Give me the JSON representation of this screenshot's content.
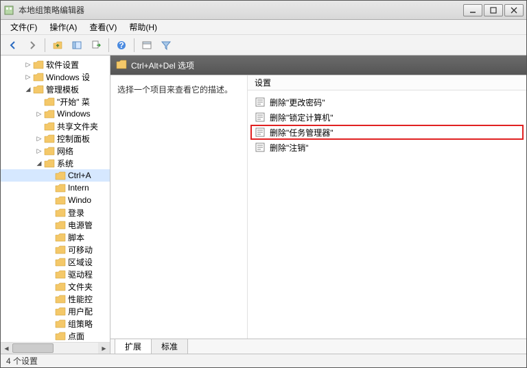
{
  "window": {
    "title": "本地组策略编辑器"
  },
  "menu": {
    "file": "文件(F)",
    "action": "操作(A)",
    "view": "查看(V)",
    "help": "帮助(H)"
  },
  "tree": {
    "items": [
      {
        "label": "软件设置",
        "indent": 1,
        "exp": "▷"
      },
      {
        "label": "Windows 设",
        "indent": 1,
        "exp": "▷"
      },
      {
        "label": "管理模板",
        "indent": 1,
        "exp": "◢"
      },
      {
        "label": "\"开始\" 菜",
        "indent": 2,
        "exp": ""
      },
      {
        "label": "Windows",
        "indent": 2,
        "exp": "▷"
      },
      {
        "label": "共享文件夹",
        "indent": 2,
        "exp": ""
      },
      {
        "label": "控制面板",
        "indent": 2,
        "exp": "▷"
      },
      {
        "label": "网络",
        "indent": 2,
        "exp": "▷"
      },
      {
        "label": "系统",
        "indent": 2,
        "exp": "◢"
      },
      {
        "label": "Ctrl+A",
        "indent": 3,
        "exp": "",
        "sel": true
      },
      {
        "label": "Intern",
        "indent": 3,
        "exp": ""
      },
      {
        "label": "Windo",
        "indent": 3,
        "exp": ""
      },
      {
        "label": "登录",
        "indent": 3,
        "exp": ""
      },
      {
        "label": "电源管",
        "indent": 3,
        "exp": ""
      },
      {
        "label": "脚本",
        "indent": 3,
        "exp": ""
      },
      {
        "label": "可移动",
        "indent": 3,
        "exp": ""
      },
      {
        "label": "区域设",
        "indent": 3,
        "exp": ""
      },
      {
        "label": "驱动程",
        "indent": 3,
        "exp": ""
      },
      {
        "label": "文件夹",
        "indent": 3,
        "exp": ""
      },
      {
        "label": "性能控",
        "indent": 3,
        "exp": ""
      },
      {
        "label": "用户配",
        "indent": 3,
        "exp": ""
      },
      {
        "label": "组策略",
        "indent": 3,
        "exp": ""
      },
      {
        "label": "点面",
        "indent": 3,
        "exp": ""
      }
    ]
  },
  "path": {
    "text": "Ctrl+Alt+Del 选项"
  },
  "description": "选择一个项目来查看它的描述。",
  "settings": {
    "header": "设置",
    "items": [
      {
        "label": "删除\"更改密码\""
      },
      {
        "label": "删除\"锁定计算机\""
      },
      {
        "label": "删除\"任务管理器\"",
        "hl": true
      },
      {
        "label": "删除\"注销\""
      }
    ]
  },
  "tabs": {
    "extended": "扩展",
    "standard": "标准"
  },
  "status": "4 个设置"
}
